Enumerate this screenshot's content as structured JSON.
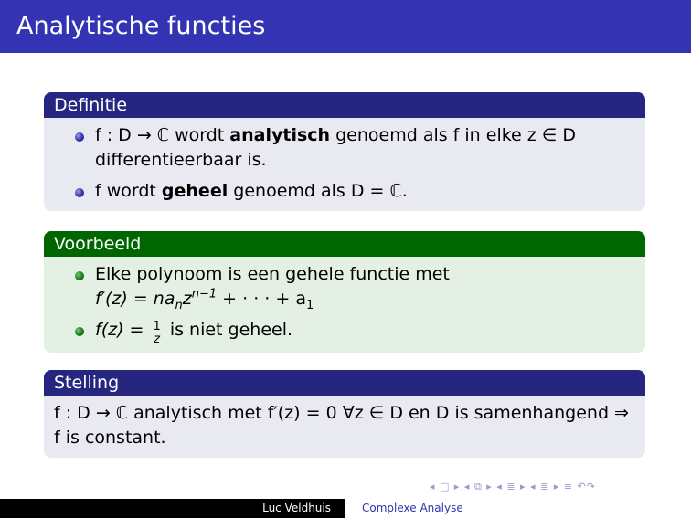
{
  "frame": {
    "title": "Analytische functies"
  },
  "blocks": {
    "definition": {
      "title": "Definitie",
      "items": [
        {
          "pre": "f : D → ℂ wordt ",
          "bold": "analytisch",
          "post": " genoemd als f in elke z ∈ D differentieerbaar is."
        },
        {
          "pre": "f wordt ",
          "bold": "geheel",
          "post": " genoemd als D = ℂ."
        }
      ]
    },
    "example": {
      "title": "Voorbeeld",
      "items": [
        {
          "line1": "Elke polynoom is een gehele functie met",
          "formula_pre": "f′(z) = na",
          "sub_n": "n",
          "formula_z": "z",
          "sup": "n−1",
          "formula_post": " + · · · + a",
          "sub_1": "1"
        },
        {
          "pre": "f(z) = ",
          "frac_num": "1",
          "frac_den": "z",
          "post": " is niet geheel."
        }
      ]
    },
    "theorem": {
      "title": "Stelling",
      "text": "f : D → ℂ analytisch met f′(z) = 0 ∀z ∈ D en D is samenhangend ⇒ f is constant."
    }
  },
  "navigation": {
    "symbols": "◂ □ ▸ ◂ ⧉ ▸ ◂ ≣ ▸ ◂ ≣ ▸   ≡   ↶↷"
  },
  "footer": {
    "author": "Luc Veldhuis",
    "title": "Complexe Analyse"
  }
}
